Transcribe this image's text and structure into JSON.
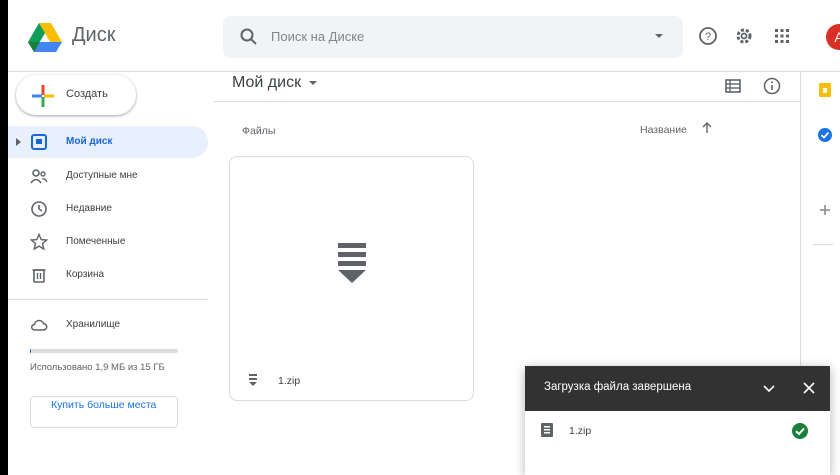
{
  "app": {
    "name": "Диск",
    "avatar_letter": "A",
    "accent": "#1a73e8"
  },
  "search": {
    "placeholder": "Поиск на Диске"
  },
  "topbar_icons": [
    "search-icon",
    "dropdown-icon",
    "help-icon",
    "settings-icon",
    "apps-grid-icon"
  ],
  "sidebar": {
    "create_label": "Создать",
    "items": [
      {
        "label": "Мой диск",
        "icon": "my-drive-icon",
        "active": true
      },
      {
        "label": "Доступные мне",
        "icon": "shared-icon",
        "active": false
      },
      {
        "label": "Недавние",
        "icon": "clock-icon",
        "active": false
      },
      {
        "label": "Помеченные",
        "icon": "star-icon",
        "active": false
      },
      {
        "label": "Корзина",
        "icon": "trash-icon",
        "active": false
      }
    ],
    "storage_label": "Хранилище",
    "quota_text": "Использовано 1,9 МБ из 15 ГБ",
    "quota_used_fraction": 0.0001,
    "buy_label": "Купить больше места"
  },
  "main": {
    "title": "Мой диск",
    "files_label": "Файлы",
    "sort_label": "Название",
    "files": [
      {
        "name": "1.zip",
        "icon": "archive-icon"
      }
    ]
  },
  "toast": {
    "title": "Загрузка файла завершена",
    "file": "1.zip",
    "status": "complete"
  }
}
